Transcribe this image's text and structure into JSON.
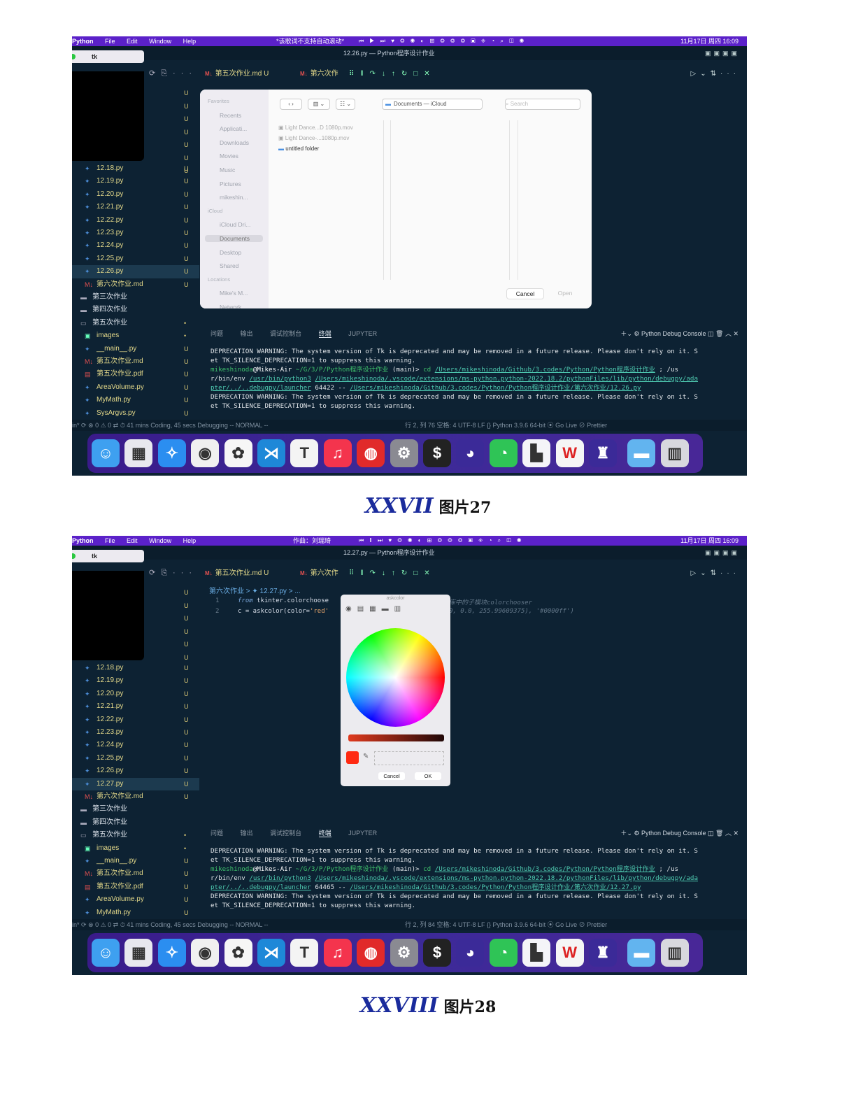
{
  "screenshots": [
    {
      "menubar": {
        "app": "Python",
        "menus": [
          "File",
          "Edit",
          "Window",
          "Help"
        ],
        "center_text": "*该歌词不支持自动滚动*",
        "datetime": "11月17日 周四 16:09"
      },
      "window_title": "12.26.py — Python程序设计作业",
      "tk_tab": "tk",
      "tabs": {
        "tab1": "第五次作业.md U",
        "tab2": "第六次作"
      },
      "breadcrumb": "",
      "files": [
        {
          "name": "12.18.py",
          "status": "U",
          "icon": "python-icon"
        },
        {
          "name": "12.19.py",
          "status": "U",
          "icon": "python-icon"
        },
        {
          "name": "12.20.py",
          "status": "U",
          "icon": "python-icon"
        },
        {
          "name": "12.21.py",
          "status": "U",
          "icon": "python-icon"
        },
        {
          "name": "12.22.py",
          "status": "U",
          "icon": "python-icon"
        },
        {
          "name": "12.23.py",
          "status": "U",
          "icon": "python-icon"
        },
        {
          "name": "12.24.py",
          "status": "U",
          "icon": "python-icon"
        },
        {
          "name": "12.25.py",
          "status": "U",
          "icon": "python-icon"
        },
        {
          "name": "12.26.py",
          "status": "U",
          "icon": "python-icon",
          "selected": true
        },
        {
          "name": "第六次作业.md",
          "status": "U",
          "icon": "markdown-icon"
        },
        {
          "name": "第三次作业",
          "status": "",
          "icon": "folder-icon",
          "dir": true
        },
        {
          "name": "第四次作业",
          "status": "",
          "icon": "folder-icon",
          "dir": true
        },
        {
          "name": "第五次作业",
          "status": "•",
          "icon": "folder-open-icon",
          "dir": true
        },
        {
          "name": "images",
          "status": "•",
          "icon": "image-folder-icon"
        },
        {
          "name": "__main__.py",
          "status": "U",
          "icon": "python-icon"
        },
        {
          "name": "第五次作业.md",
          "status": "U",
          "icon": "markdown-icon"
        },
        {
          "name": "第五次作业.pdf",
          "status": "U",
          "icon": "pdf-icon"
        },
        {
          "name": "AreaVolume.py",
          "status": "U",
          "icon": "python-icon"
        },
        {
          "name": "MyMath.py",
          "status": "U",
          "icon": "python-icon"
        },
        {
          "name": "SysArgvs.py",
          "status": "U",
          "icon": "python-icon"
        }
      ],
      "panel_tabs": [
        "问题",
        "输出",
        "调试控制台",
        "终端",
        "JUPYTER"
      ],
      "panel_right": "Python Debug Console",
      "terminal": {
        "warn1": "DEPRECATION WARNING: The system version of Tk is deprecated and may be removed in a future release. Please don't rely on it. S",
        "warn1b": "et TK_SILENCE_DEPRECATION=1 to suppress this warning.",
        "prompt_user": "mikeshinoda",
        "prompt_host": "@Mikes-Air",
        "prompt_path": " ~/G/3/P/Python程序设计作业",
        "prompt_branch": " (main)>  ",
        "cmd1": "cd ",
        "path1": "/Users/mikeshinoda/Github/3.codes/Python/Python程序设计作业",
        "cmd2": " ; /us",
        "line2a": "r/bin/env ",
        "path2": "/usr/bin/python3",
        "path3": "/Users/mikeshinoda/.vscode/extensions/ms-python.python-2022.18.2/pythonFiles/lib/python/debugpy/ada",
        "line3a": "pter/../..debugpy/launcher",
        "port": " 64422 -- ",
        "path4": "/Users/mikeshinoda/Github/3.codes/Python/Python程序设计作业/第六次作业/12.26.py",
        "warn2": "DEPRECATION WARNING: The system version of Tk is deprecated and may be removed in a future release. Please don't rely on it. S",
        "warn2b": "et TK_SILENCE_DEPRECATION=1 to suppress this warning."
      },
      "statusbar": {
        "left": "in*  ⟳  ⊗ 0 ⚠ 0   ⇄   ⏱ 41 mins Coding, 45 secs Debugging    -- NORMAL --",
        "right": "行 2, 列 76    空格: 4    UTF-8    LF    {} Python    3.9.6 64-bit    ⦿ Go Live    ⊘ Prettier"
      },
      "dialog": {
        "location": "Documents — iCloud",
        "search_placeholder": "Search",
        "sidebar": [
          "Favorites",
          "Recents",
          "Applicati...",
          "Downloads",
          "Movies",
          "Music",
          "Pictures",
          "mikeshin...",
          "iCloud",
          "iCloud Dri...",
          "Documents",
          "Desktop",
          "Shared",
          "Locations",
          "Mike's M...",
          "Network"
        ],
        "items": [
          "Light Dance...D 1080p.mov",
          "Light Dance-...1080p.mov",
          "untitled folder"
        ],
        "cancel": "Cancel",
        "open": "Open"
      }
    },
    {
      "menubar": {
        "app": "Python",
        "menus": [
          "File",
          "Edit",
          "Window",
          "Help"
        ],
        "center_text": "作曲：刘瑞琦",
        "datetime": "11月17日 周四 16:09"
      },
      "window_title": "12.27.py — Python程序设计作业",
      "tk_tab": "tk",
      "tabs": {
        "tab1": "第五次作业.md U",
        "tab2": "第六次作"
      },
      "breadcrumb": "第六次作业 > ✦ 12.27.py > ...",
      "code": {
        "l1_num": "1",
        "l1_kw": "from",
        "l1_rest": " tkinter.colorchoose",
        "l2_num": "2",
        "l2_a": "c = askcolor(color=",
        "l2_str": "'red'",
        "comment1": "库中的子模块colorchooser",
        "comment2": "0, 0.0, 255.99609375), '#0000ff')"
      },
      "files": [
        {
          "name": "12.18.py",
          "status": "U",
          "icon": "python-icon"
        },
        {
          "name": "12.19.py",
          "status": "U",
          "icon": "python-icon"
        },
        {
          "name": "12.20.py",
          "status": "U",
          "icon": "python-icon"
        },
        {
          "name": "12.21.py",
          "status": "U",
          "icon": "python-icon"
        },
        {
          "name": "12.22.py",
          "status": "U",
          "icon": "python-icon"
        },
        {
          "name": "12.23.py",
          "status": "U",
          "icon": "python-icon"
        },
        {
          "name": "12.24.py",
          "status": "U",
          "icon": "python-icon"
        },
        {
          "name": "12.25.py",
          "status": "U",
          "icon": "python-icon"
        },
        {
          "name": "12.26.py",
          "status": "U",
          "icon": "python-icon"
        },
        {
          "name": "12.27.py",
          "status": "U",
          "icon": "python-icon",
          "selected": true
        },
        {
          "name": "第六次作业.md",
          "status": "U",
          "icon": "markdown-icon"
        },
        {
          "name": "第三次作业",
          "status": "",
          "icon": "folder-icon",
          "dir": true
        },
        {
          "name": "第四次作业",
          "status": "",
          "icon": "folder-icon",
          "dir": true
        },
        {
          "name": "第五次作业",
          "status": "•",
          "icon": "folder-open-icon",
          "dir": true
        },
        {
          "name": "images",
          "status": "•",
          "icon": "image-folder-icon"
        },
        {
          "name": "__main__.py",
          "status": "U",
          "icon": "python-icon"
        },
        {
          "name": "第五次作业.md",
          "status": "U",
          "icon": "markdown-icon"
        },
        {
          "name": "第五次作业.pdf",
          "status": "U",
          "icon": "pdf-icon"
        },
        {
          "name": "AreaVolume.py",
          "status": "U",
          "icon": "python-icon"
        },
        {
          "name": "MyMath.py",
          "status": "U",
          "icon": "python-icon"
        }
      ],
      "panel_tabs": [
        "问题",
        "输出",
        "调试控制台",
        "终端",
        "JUPYTER"
      ],
      "panel_right": "Python Debug Console",
      "terminal": {
        "warn1": "DEPRECATION WARNING: The system version of Tk is deprecated and may be removed in a future release. Please don't rely on it. S",
        "warn1b": "et TK_SILENCE_DEPRECATION=1 to suppress this warning.",
        "prompt_user": "mikeshinoda",
        "prompt_host": "@Mikes-Air",
        "prompt_path": " ~/G/3/P/Python程序设计作业",
        "prompt_branch": " (main)>  ",
        "cmd1": "cd ",
        "path1": "/Users/mikeshinoda/Github/3.codes/Python/Python程序设计作业",
        "cmd2": " ; /us",
        "line2a": "r/bin/env ",
        "path2": "/usr/bin/python3",
        "path3": "/Users/mikeshinoda/.vscode/extensions/ms-python.python-2022.18.2/pythonFiles/lib/python/debugpy/ada",
        "line3a": "pter/../..debugpy/launcher",
        "port": " 64465 -- ",
        "path4": "/Users/mikeshinoda/Github/3.codes/Python/Python程序设计作业/第六次作业/12.27.py",
        "warn2": "DEPRECATION WARNING: The system version of Tk is deprecated and may be removed in a future release. Please don't rely on it. S",
        "warn2b": "et TK_SILENCE_DEPRECATION=1 to suppress this warning."
      },
      "statusbar": {
        "left": "in*  ⟳  ⊗ 0 ⚠ 0   ⇄   ⏱ 41 mins Coding, 45 secs Debugging    -- NORMAL --",
        "right": "行 2, 列 84    空格: 4    UTF-8    LF    {} Python    3.9.6 64-bit    ⦿ Go Live    ⊘ Prettier"
      },
      "colorchooser": {
        "title": "askcolor",
        "cancel": "Cancel",
        "ok": "OK",
        "selected_color": "#ff2a12"
      }
    }
  ],
  "captions": [
    {
      "roman": "XXVII",
      "text": "图片27"
    },
    {
      "roman": "XXVIII",
      "text": "图片28"
    }
  ],
  "dock_icons": [
    "finder-icon",
    "launchpad-icon",
    "safari-icon",
    "chrome-icon",
    "photos-icon",
    "vscode-icon",
    "typora-icon",
    "music-icon",
    "netease-music-icon",
    "system-preferences-icon",
    "terminal-icon",
    "qq-icon",
    "wechat-icon",
    "lark-icon",
    "wps-icon",
    "python-launcher-icon",
    "folder-icon",
    "trash-icon"
  ],
  "colors": {
    "menubar": "#5b21c9",
    "editor_bg": "#0d2233",
    "file_text": "#e4d98a",
    "caption_roman": "#1a2b9c"
  }
}
